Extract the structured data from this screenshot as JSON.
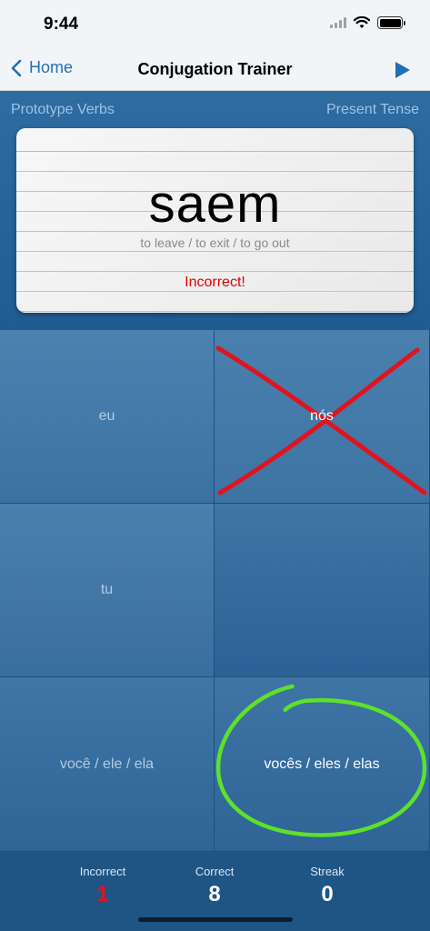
{
  "status_bar": {
    "time": "9:44"
  },
  "nav": {
    "back_label": "Home",
    "title": "Conjugation Trainer",
    "play_icon": "play-icon"
  },
  "header": {
    "verb_set": "Prototype Verbs",
    "tense": "Present Tense"
  },
  "card": {
    "word": "saem",
    "translation": "to leave / to exit / to go out",
    "result": "Incorrect!",
    "result_color": "#e00000"
  },
  "grid": {
    "cells": [
      {
        "label": "eu",
        "mark": "none"
      },
      {
        "label": "nós",
        "mark": "red-x"
      },
      {
        "label": "tu",
        "mark": "none"
      },
      {
        "label": "",
        "mark": "none"
      },
      {
        "label": "você / ele / ela",
        "mark": "none"
      },
      {
        "label": "vocês / eles / elas",
        "mark": "green-circle"
      }
    ],
    "mark_colors": {
      "incorrect": "#e0141e",
      "correct": "#5ee12a"
    }
  },
  "stats": {
    "incorrect_label": "Incorrect",
    "incorrect_value": "1",
    "incorrect_color": "#e0141e",
    "correct_label": "Correct",
    "correct_value": "8",
    "streak_label": "Streak",
    "streak_value": "0"
  }
}
